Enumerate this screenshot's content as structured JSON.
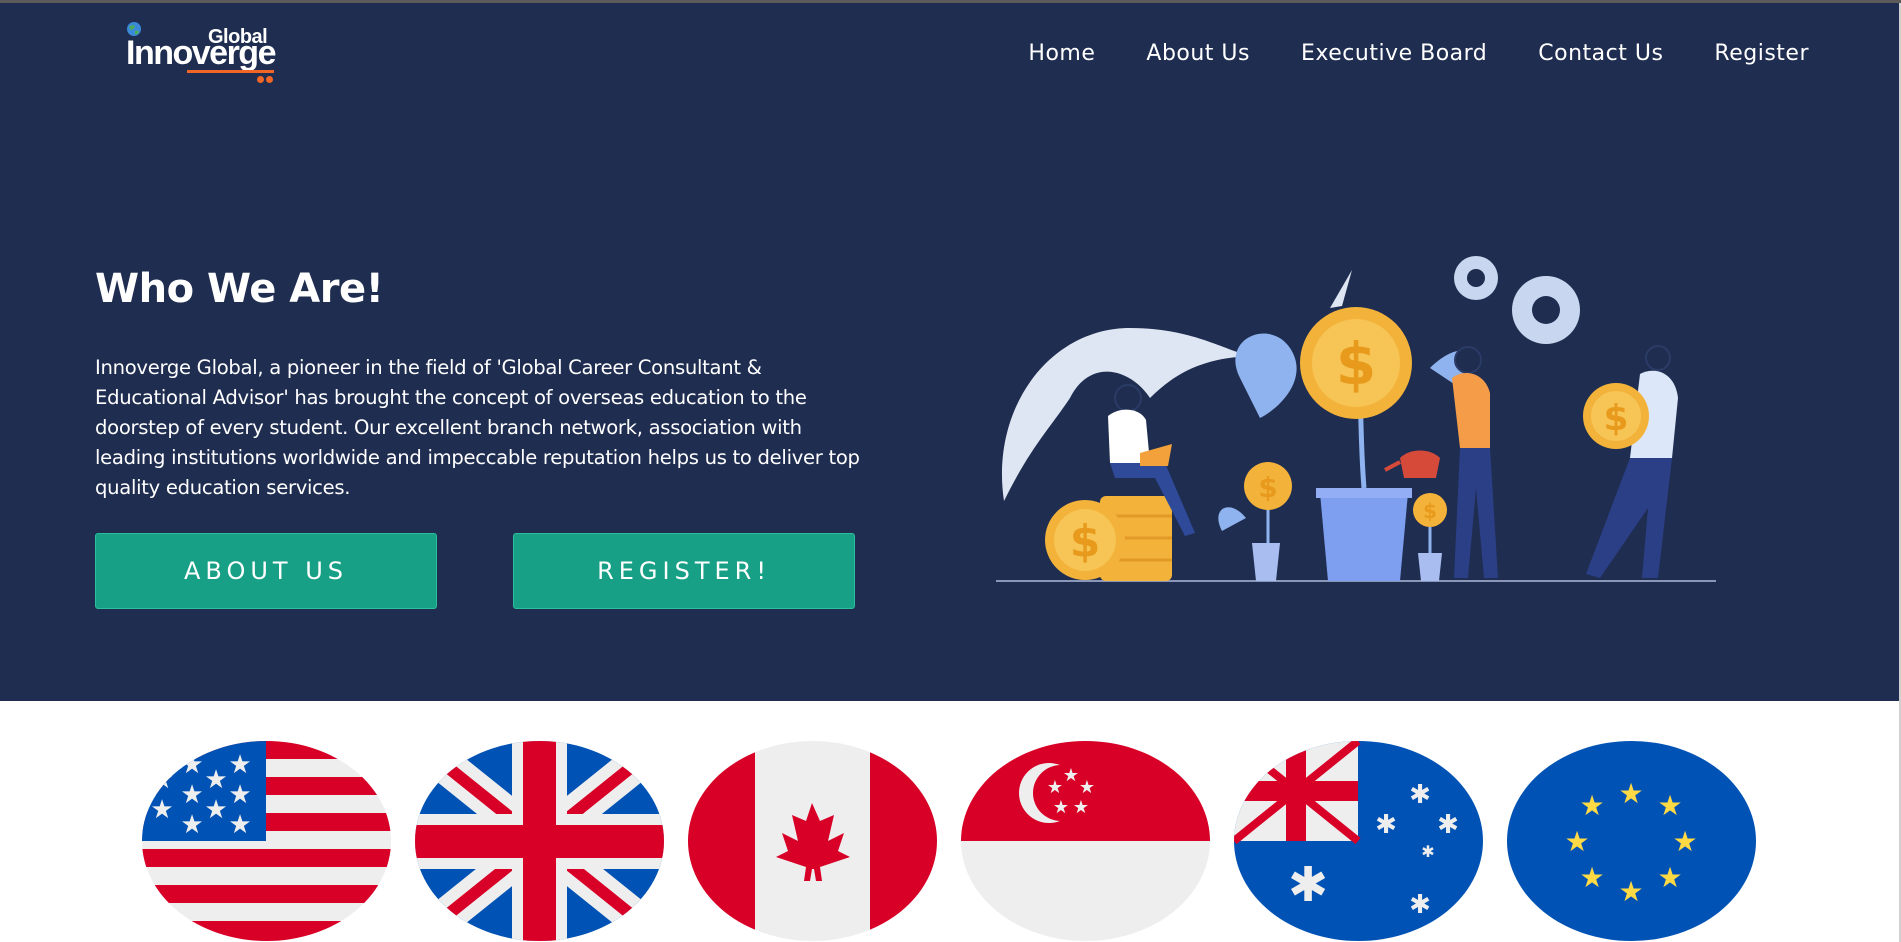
{
  "brand": {
    "logo_top": "Global",
    "logo_name": "Innoverge",
    "colors": {
      "navy": "#1f2d50",
      "accent": "#f16526",
      "button": "#17a085"
    }
  },
  "nav": {
    "items": [
      {
        "label": "Home"
      },
      {
        "label": "About Us"
      },
      {
        "label": "Executive Board"
      },
      {
        "label": "Contact Us"
      },
      {
        "label": "Register"
      }
    ]
  },
  "hero": {
    "title": "Who We Are!",
    "body": "Innoverge Global, a pioneer in the field of 'Global Career Consultant & Educational Advisor' has brought the concept of overseas education to the doorstep of every student. Our excellent branch network, association with leading institutions worldwide and impeccable reputation helps us to deliver top quality education services.",
    "about_button": "ABOUT US",
    "register_button": "REGISTER!",
    "illustration": "people-growing-money-plants-illustration"
  },
  "flags": [
    {
      "country": "usa-flag-icon"
    },
    {
      "country": "uk-flag-icon"
    },
    {
      "country": "canada-flag-icon"
    },
    {
      "country": "singapore-flag-icon"
    },
    {
      "country": "australia-flag-icon"
    },
    {
      "country": "eu-flag-icon"
    }
  ]
}
